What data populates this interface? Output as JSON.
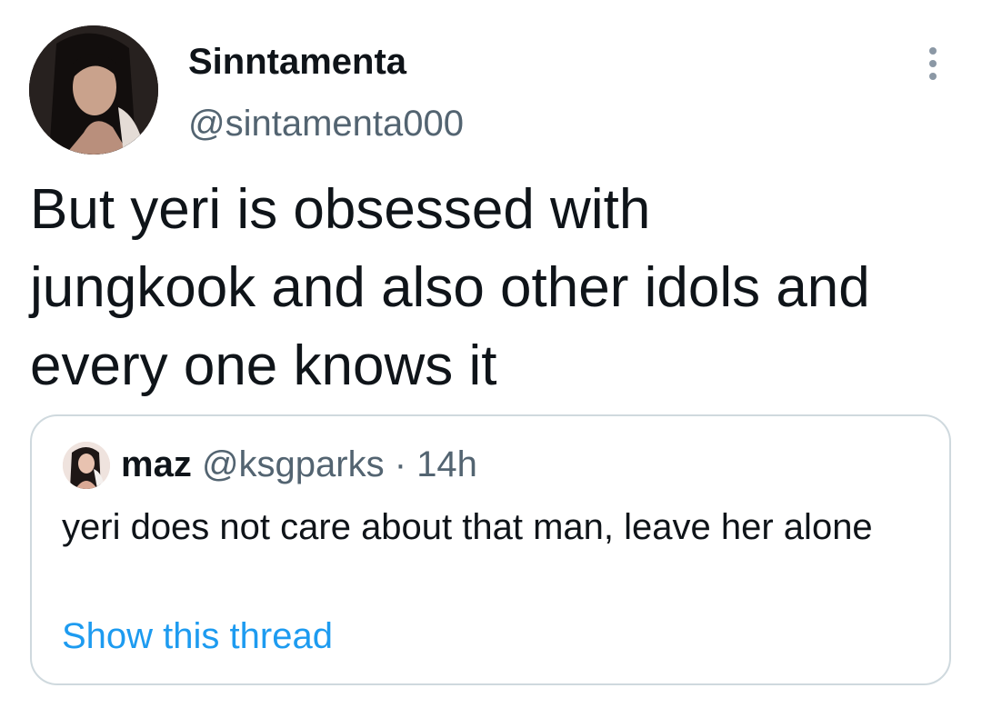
{
  "tweet": {
    "author": {
      "display_name": "Sinntamenta",
      "handle": "@sintamenta000"
    },
    "text": "But yeri is obsessed with\njungkook and also other idols and\nevery one knows it",
    "more_icon": "more-vertical-icon"
  },
  "quoted_tweet": {
    "author": {
      "display_name": "maz",
      "handle": "@ksgparks"
    },
    "separator": "·",
    "time": "14h",
    "text": "yeri does not care about that man, leave her alone",
    "show_thread_label": "Show this thread"
  },
  "colors": {
    "primary_text": "#0f1419",
    "secondary_text": "#536471",
    "link": "#1d9bf0",
    "border": "#cfd9de"
  }
}
